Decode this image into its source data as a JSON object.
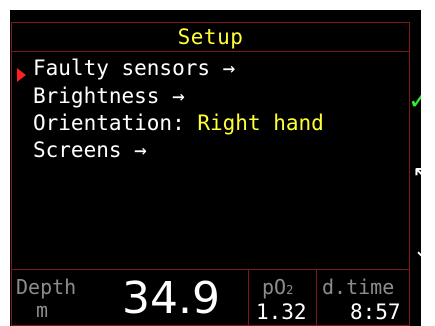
{
  "title": "Setup",
  "menu": {
    "items": [
      {
        "label": "Faulty sensors →",
        "value": ""
      },
      {
        "label": "Brightness →",
        "value": ""
      },
      {
        "label": "Orientation: ",
        "value": "Right hand"
      },
      {
        "label": "Screens →",
        "value": ""
      }
    ],
    "selected_index": 0
  },
  "side_buttons": {
    "confirm_icon": "check-icon",
    "confirm_glyph": "✓",
    "back_icon": "arrow-up-left-icon",
    "back_glyph": "↖",
    "down_icon": "arrow-down-icon",
    "down_glyph": "↓"
  },
  "status": {
    "depth_label": "Depth",
    "depth_unit": "m",
    "depth_value": "34.9",
    "po2_label": "pO",
    "po2_subscript": "2",
    "po2_value": "1.32",
    "dive_time_label": "d.time",
    "dive_time_value": "8:57"
  },
  "colors": {
    "background": "#000000",
    "title_text": "#ffff33",
    "menu_text": "#ffffff",
    "value_text": "#ffff33",
    "cursor": "#ff2020",
    "border": "#7a1a1a",
    "confirm": "#33ee33",
    "status_label": "#8c8c8c"
  }
}
